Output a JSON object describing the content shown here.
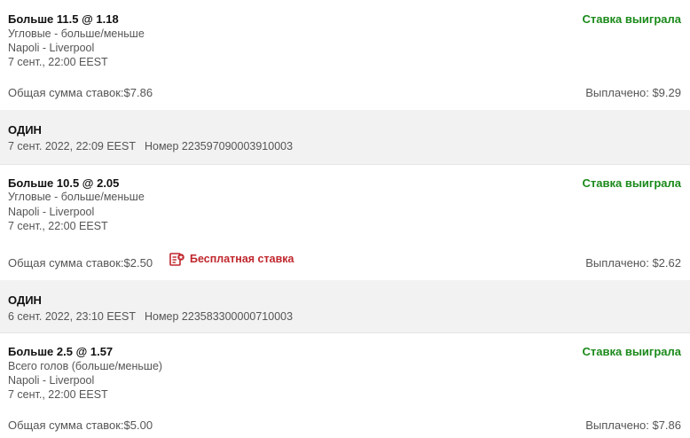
{
  "bets": [
    {
      "selection": "Больше 11.5 @ 1.18",
      "market": "Угловые - больше/меньше",
      "event": "Napoli - Liverpool",
      "start": "7 сент., 22:00 EEST",
      "status": "Ставка выиграла",
      "stake": "Общая сумма ставок:$7.86",
      "payout": "Выплачено: $9.29"
    },
    {
      "selection": "Больше 10.5 @ 2.05",
      "market": "Угловые - больше/меньше",
      "event": "Napoli - Liverpool",
      "start": "7 сент., 22:00 EEST",
      "status": "Ставка выиграла",
      "stake": "Общая сумма ставок:$2.50",
      "free_bet_label": "Бесплатная ставка",
      "payout": "Выплачено: $2.62"
    },
    {
      "selection": "Больше 2.5 @ 1.57",
      "market": "Всего голов (больше/меньше)",
      "event": "Napoli - Liverpool",
      "start": "7 сент., 22:00 EEST",
      "status": "Ставка выиграла",
      "stake": "Общая сумма ставок:$5.00",
      "payout": "Выплачено: $7.86"
    }
  ],
  "groups": [
    {
      "type": "ОДИН",
      "date": "7 сент. 2022, 22:09 EEST",
      "number": "Номер 223597090003910003"
    },
    {
      "type": "ОДИН",
      "date": "6 сент. 2022, 23:10 EEST",
      "number": "Номер 223583300000710003"
    }
  ],
  "colors": {
    "won": "#1b8a1b",
    "free_bet": "#c0272d",
    "group_bg": "#f2f2f2"
  },
  "icons": {
    "free_bet": "free-bet-ticket-icon"
  }
}
